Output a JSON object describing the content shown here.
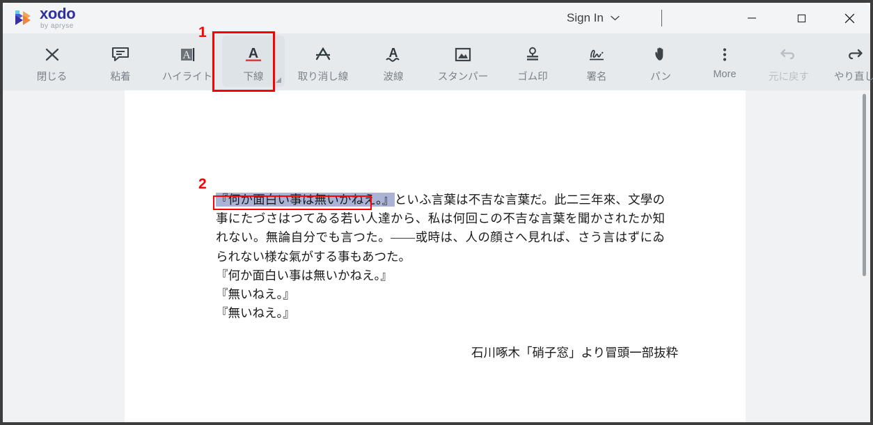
{
  "window": {
    "brand_name": "xodo",
    "brand_tagline": "by apryse",
    "sign_in_label": "Sign In",
    "minimize_label": "—",
    "maximize_label": "□",
    "close_label": "✕"
  },
  "toolbar": {
    "items": [
      {
        "label": "閉じる",
        "icon": "close-x-icon",
        "state": "normal"
      },
      {
        "label": "粘着",
        "icon": "sticky-note-icon",
        "state": "normal"
      },
      {
        "label": "ハイライト",
        "icon": "text-highlight-icon",
        "state": "normal"
      },
      {
        "label": "下線",
        "icon": "underline-icon",
        "state": "selected"
      },
      {
        "label": "取り消し線",
        "icon": "strikethrough-icon",
        "state": "normal"
      },
      {
        "label": "波線",
        "icon": "squiggly-underline-icon",
        "state": "normal"
      },
      {
        "label": "スタンパー",
        "icon": "image-stamp-icon",
        "state": "normal"
      },
      {
        "label": "ゴム印",
        "icon": "rubber-stamp-icon",
        "state": "normal"
      },
      {
        "label": "署名",
        "icon": "signature-icon",
        "state": "normal"
      },
      {
        "label": "パン",
        "icon": "pan-hand-icon",
        "state": "normal"
      },
      {
        "label": "More",
        "icon": "more-vertical-dots-icon",
        "state": "normal"
      },
      {
        "label": "元に戻す",
        "icon": "undo-arrow-icon",
        "state": "disabled"
      },
      {
        "label": "やり直し",
        "icon": "redo-arrow-icon",
        "state": "normal"
      }
    ]
  },
  "annotations": {
    "marker_1": "1",
    "marker_2": "2",
    "accent_color": "#ff0000"
  },
  "document": {
    "selected_text": "『何か面白い事は無いかねえ。』",
    "paragraph_rest": "といふ言葉は不吉な言葉だ。此二三年來、文學の事にたづさはつてゐる若い人達から、私は何回この不吉な言葉を聞かされたか知れない。無論自分でも言つた。——或時は、人の顔さへ見れば、さう言はずにゐられない様な氣がする事もあつた。",
    "line_2": "『何か面白い事は無いかねえ。』",
    "line_3": "『無いねえ。』",
    "line_4": "『無いねえ。』",
    "attribution": "石川啄木「硝子窓」より冒頭一部抜粋"
  }
}
